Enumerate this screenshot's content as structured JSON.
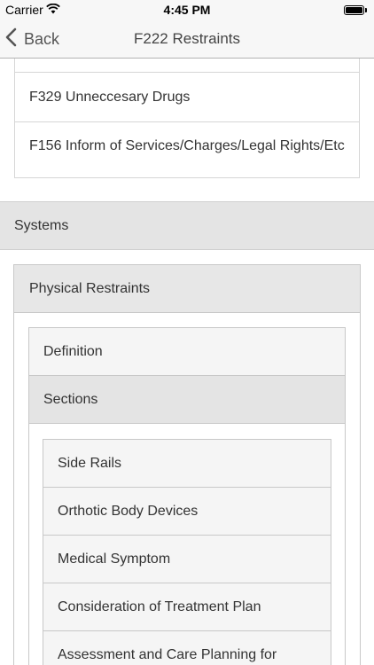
{
  "status_bar": {
    "carrier": "Carrier",
    "time": "4:45 PM"
  },
  "nav": {
    "back_label": "Back",
    "title": "F222 Restraints"
  },
  "top_list": {
    "items": [
      "F329 Unneccesary Drugs",
      "F156 Inform of Services/Charges/Legal Rights/Etc"
    ]
  },
  "systems": {
    "label": "Systems"
  },
  "physical_restraints": {
    "label": "Physical Restraints",
    "definition_label": "Definition",
    "sections_label": "Sections",
    "sections": [
      "Side Rails",
      "Orthotic Body Devices",
      "Medical Symptom",
      "Consideration of Treatment Plan",
      "Assessment and Care Planning for"
    ]
  }
}
